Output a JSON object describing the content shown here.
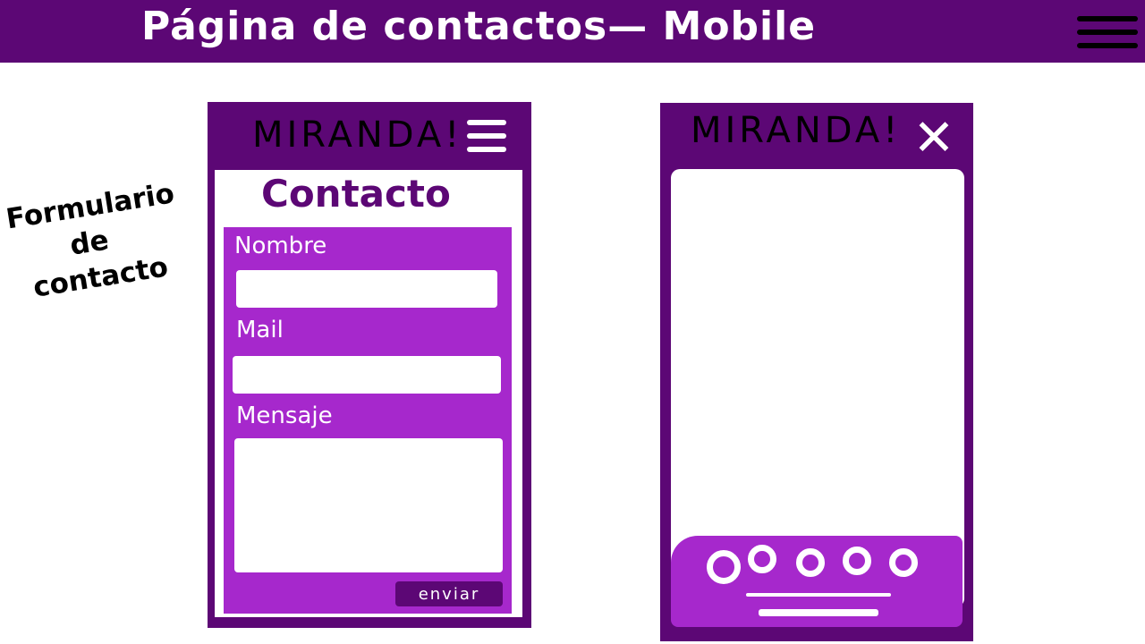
{
  "header": {
    "title": "Página de contactos—  Mobile",
    "menu_icon": "hamburger-menu-icon"
  },
  "annotation": {
    "lines": [
      "Formulario",
      "de",
      "contacto"
    ]
  },
  "phone_left": {
    "brand": "MIRANDA!",
    "menu_icon": "hamburger-menu-icon",
    "section_title": "Contacto",
    "form": {
      "name_label": "Nombre",
      "name_value": "",
      "mail_label": "Mail",
      "mail_value": "",
      "message_label": "Mensaje",
      "message_value": "",
      "submit_label": "enviar"
    }
  },
  "phone_right": {
    "brand": "MIRANDA!",
    "close_icon": "close-icon",
    "footer_icons": [
      "circle-icon",
      "circle-icon",
      "circle-icon",
      "circle-icon",
      "circle-icon"
    ]
  },
  "colors": {
    "dark_purple": "#5c0775",
    "light_purple": "#a628cc",
    "white": "#ffffff",
    "black": "#000000"
  }
}
